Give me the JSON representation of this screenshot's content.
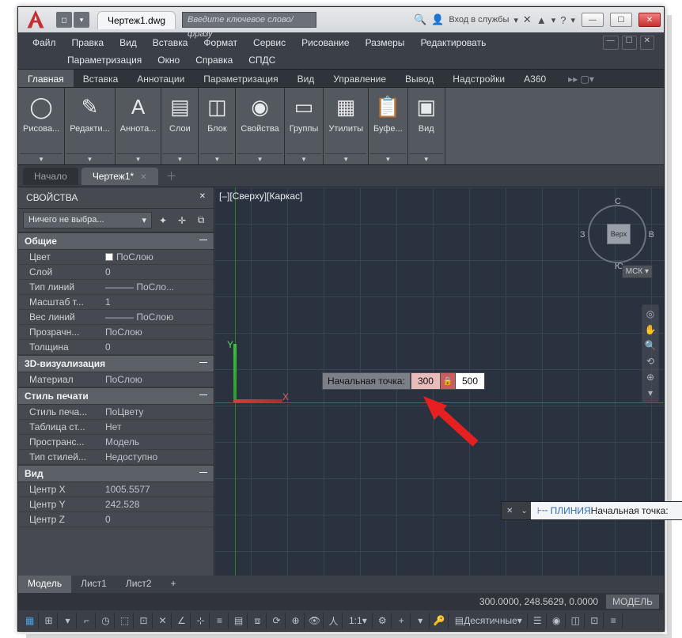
{
  "titlebar": {
    "doc_title": "Чертеж1.dwg",
    "search_placeholder": "Введите ключевое слово/фразу",
    "login_label": "Вход в службы"
  },
  "menu": [
    "Файл",
    "Правка",
    "Вид",
    "Вставка",
    "Формат",
    "Сервис",
    "Рисование",
    "Размеры",
    "Редактировать",
    "Параметризация",
    "Окно",
    "Справка",
    "СПДС"
  ],
  "ribbon_tabs": [
    "Главная",
    "Вставка",
    "Аннотации",
    "Параметризация",
    "Вид",
    "Управление",
    "Вывод",
    "Надстройки",
    "A360"
  ],
  "ribbon_panels": [
    {
      "label": "Рисова...",
      "icon": "◯"
    },
    {
      "label": "Редакти...",
      "icon": "✎"
    },
    {
      "label": "Аннота...",
      "icon": "A"
    },
    {
      "label": "Слои",
      "icon": "▤"
    },
    {
      "label": "Блок",
      "icon": "◫"
    },
    {
      "label": "Свойства",
      "icon": "◉"
    },
    {
      "label": "Группы",
      "icon": "▭"
    },
    {
      "label": "Утилиты",
      "icon": "▦"
    },
    {
      "label": "Буфе...",
      "icon": "📋"
    },
    {
      "label": "Вид",
      "icon": "▣"
    }
  ],
  "file_tabs": {
    "start": "Начало",
    "active": "Чертеж1*"
  },
  "view_label": "[–][Сверху][Каркас]",
  "props": {
    "title": "СВОЙСТВА",
    "combo": "Ничего не выбра...",
    "cats": {
      "general": "Общие",
      "viz": "3D-визуализация",
      "plot": "Стиль печати",
      "view": "Вид"
    },
    "general_rows": [
      {
        "k": "Цвет",
        "v": "ПоСлою",
        "swatch": true
      },
      {
        "k": "Слой",
        "v": "0"
      },
      {
        "k": "Тип линий",
        "v": "——— ПоСло..."
      },
      {
        "k": "Масштаб т...",
        "v": "1"
      },
      {
        "k": "Вес линий",
        "v": "——— ПоСлою"
      },
      {
        "k": "Прозрачн...",
        "v": "ПоСлою"
      },
      {
        "k": "Толщина",
        "v": "0"
      }
    ],
    "viz_rows": [
      {
        "k": "Материал",
        "v": "ПоСлою"
      }
    ],
    "plot_rows": [
      {
        "k": "Стиль печа...",
        "v": "ПоЦвету"
      },
      {
        "k": "Таблица ст...",
        "v": "Нет"
      },
      {
        "k": "Пространс...",
        "v": "Модель"
      },
      {
        "k": "Тип стилей...",
        "v": "Недоступно"
      }
    ],
    "view_rows": [
      {
        "k": "Центр X",
        "v": "1005.5577"
      },
      {
        "k": "Центр Y",
        "v": "242.528"
      },
      {
        "k": "Центр Z",
        "v": "0"
      }
    ]
  },
  "dynamic_input": {
    "label": "Начальная точка:",
    "v1": "300",
    "v2": "500"
  },
  "command": {
    "prefix": "⊦╌ ПЛИНИЯ",
    "text": " Начальная точка:"
  },
  "layout_tabs": [
    "Модель",
    "Лист1",
    "Лист2"
  ],
  "coords": "300.0000, 248.5629, 0.0000",
  "space": "МОДЕЛЬ",
  "viewcube": {
    "top": "Верх",
    "n": "С",
    "e": "В",
    "s": "Ю",
    "w": "З",
    "ucs": "МСК"
  },
  "status": {
    "scale": "1:1",
    "units": "Десятичные"
  }
}
